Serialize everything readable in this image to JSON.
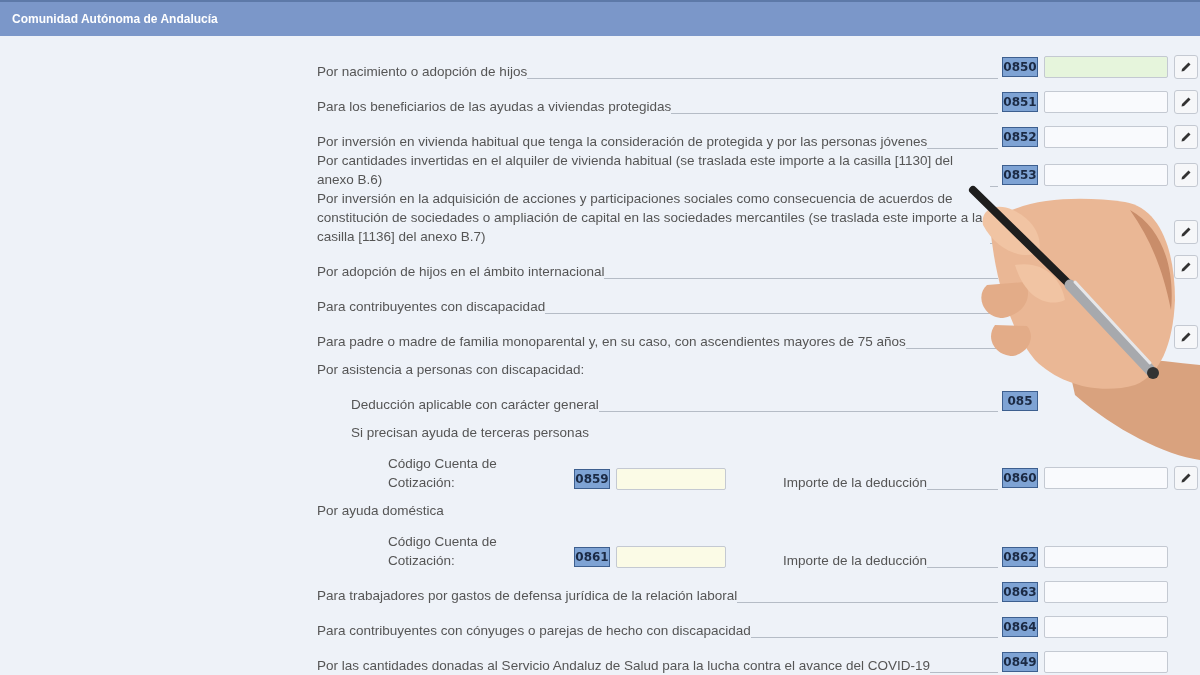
{
  "header": {
    "title": "Comunidad Autónoma de Andalucía"
  },
  "rows": [
    {
      "kind": "line",
      "label": "Por nacimiento o adopción de hijos",
      "code": "0850",
      "field": {
        "color": "#e6f5dc"
      },
      "edit": true
    },
    {
      "kind": "line",
      "label": "Para los beneficiarios de las ayudas a viviendas protegidas",
      "code": "0851",
      "field": {
        "color": "#f9fafd"
      },
      "edit": true
    },
    {
      "kind": "line",
      "label": "Por inversión en vivienda habitual que tenga la consideración de protegida y por las personas jóvenes",
      "code": "0852",
      "field": {
        "color": "#f9fafd"
      },
      "edit": true
    },
    {
      "kind": "line",
      "label": "Por cantidades invertidas en el alquiler de vivienda habitual (se traslada este importe a la casilla [1130] del anexo B.6)",
      "code": "0853",
      "field": {
        "color": "#f9fafd"
      },
      "edit": true
    },
    {
      "kind": "line",
      "label": "Por inversión en la adquisición de acciones y participaciones sociales como consecuencia de acuerdos de constitución de sociedades o ampliación de capital en las sociedades mercantiles (se traslada este importe a la casilla [1136] del anexo B.7)",
      "edit": true
    },
    {
      "kind": "line",
      "label": "Por adopción de hijos en el ámbito internacional",
      "edit": true
    },
    {
      "kind": "line",
      "label": "Para contribuyentes con discapacidad"
    },
    {
      "kind": "line",
      "label": "Para padre o madre de familia monoparental y, en su caso, con ascendientes mayores de 75 años",
      "edit": true
    },
    {
      "kind": "group",
      "label": "Por asistencia a personas con discapacidad:",
      "children": [
        {
          "kind": "line",
          "label": "Deducción aplicable con carácter general",
          "code": "085"
        },
        {
          "kind": "group",
          "label": "Si precisan ayuda de terceras personas",
          "children": [
            {
              "kind": "pair",
              "label": "Código Cuenta de Cotización:",
              "code": "0859",
              "field": {
                "color": "#fbfbe6"
              },
              "label2": "Importe de la deducción",
              "code2": "0860",
              "field2": {
                "color": "#f9fafd"
              },
              "edit": true
            }
          ]
        }
      ]
    },
    {
      "kind": "group",
      "label": "Por ayuda doméstica",
      "children": [
        {
          "kind": "pair",
          "label": "Código Cuenta de Cotización:",
          "code": "0861",
          "field": {
            "color": "#fbfbe6"
          },
          "label2": "Importe de la deducción",
          "code2": "0862",
          "field2": {
            "color": "#f9fafd"
          }
        }
      ]
    },
    {
      "kind": "line",
      "label": "Para trabajadores por gastos de defensa jurídica de la relación laboral",
      "code": "0863",
      "field": {
        "color": "#f9fafd"
      }
    },
    {
      "kind": "line",
      "label": "Para contribuyentes con cónyuges o parejas de hecho con discapacidad",
      "code": "0864",
      "field": {
        "color": "#f9fafd"
      }
    },
    {
      "kind": "line",
      "label": "Por las cantidades donadas al Servicio Andaluz de Salud para la lucha contra el avance del COVID-19",
      "code": "0849",
      "field": {
        "color": "#f9fafd"
      }
    }
  ]
}
